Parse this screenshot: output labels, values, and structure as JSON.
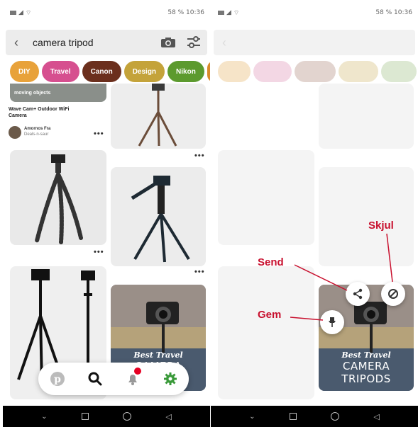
{
  "status": {
    "right_text": "58 % 10:36"
  },
  "search": {
    "query": "camera tripod"
  },
  "chips": [
    {
      "label": "DIY",
      "color": "#e8a23a"
    },
    {
      "label": "Travel",
      "color": "#d64f8f"
    },
    {
      "label": "Canon",
      "color": "#6b2f1d"
    },
    {
      "label": "Design",
      "color": "#c4a33a"
    },
    {
      "label": "Nikon",
      "color": "#5c9a2e"
    }
  ],
  "pins": {
    "first": {
      "banner": "moving objects",
      "title": "Wave Cam+ Outdoor WiFi Camera",
      "author_name": "Amornos Fra",
      "author_sub": "Deals-n-saur"
    },
    "promo": {
      "script": "Best Travel",
      "headline": "CAMERA TRIPODS"
    },
    "more_label": "•••"
  },
  "annotations": {
    "send": "Send",
    "gem": "Gem",
    "skjul": "Skjul"
  },
  "colors": {
    "accent_red": "#c8102e",
    "pinterest_red": "#e60023",
    "nav_green": "#3a9a3a"
  }
}
